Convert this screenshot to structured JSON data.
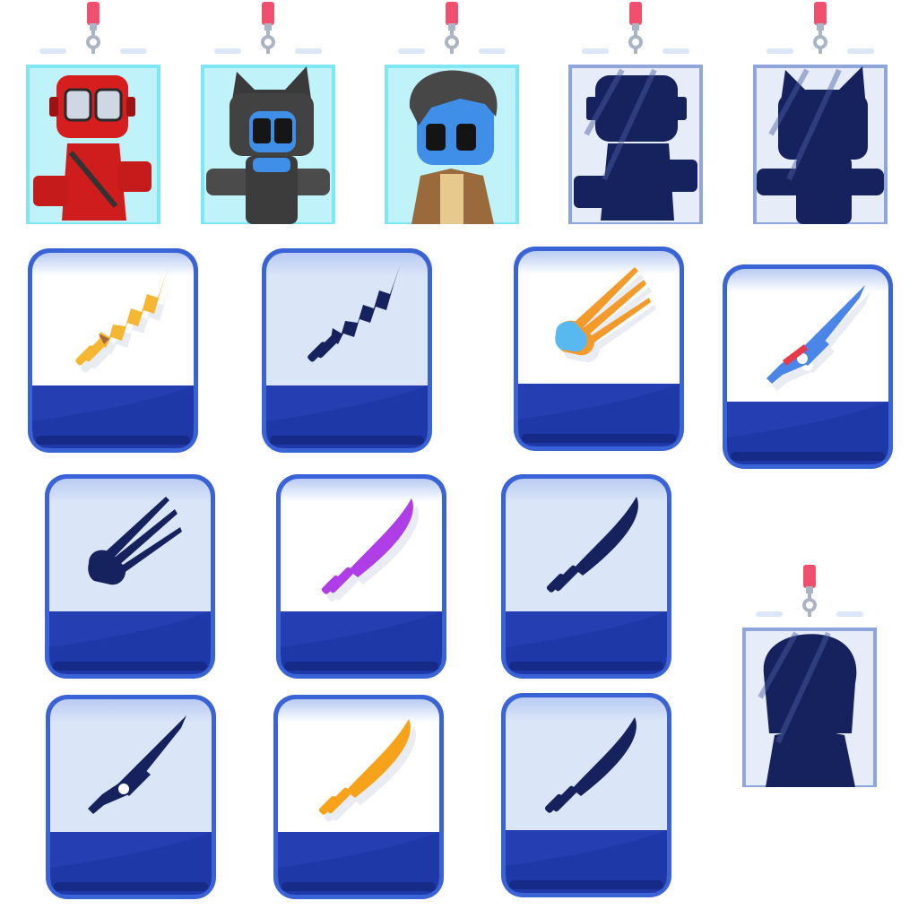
{
  "screen": {
    "title": "",
    "sections": [
      "character-badges",
      "weapon-cards"
    ]
  },
  "colors": {
    "lanyard_red": "#f0506e",
    "clip_grey": "#aab4c4",
    "unlocked_frame": "#7fe6f3",
    "unlocked_bg": "#bff3f9",
    "locked_frame": "#8ea6dc",
    "locked_bg": "#e6ecf8",
    "silhouette": "#16225e",
    "card_border": "#3b63d8",
    "card_top": "#dbe5f8",
    "card_bottom": "#1f38a8",
    "card_bottom_dark": "#162a88"
  },
  "characters": [
    {
      "id": "red-masked-robot",
      "state": "unlocked",
      "icon": "red-masked-robot-icon"
    },
    {
      "id": "cat-robot",
      "state": "unlocked",
      "icon": "cat-robot-icon"
    },
    {
      "id": "scout-soldier",
      "state": "unlocked",
      "icon": "scout-soldier-icon"
    },
    {
      "id": "masked-robot",
      "state": "locked",
      "icon": "masked-robot-silhouette-icon"
    },
    {
      "id": "cat-robot",
      "state": "locked",
      "icon": "cat-robot-silhouette-icon"
    },
    {
      "id": "scout-soldier",
      "state": "locked",
      "icon": "scout-soldier-silhouette-icon"
    }
  ],
  "weapons": [
    {
      "id": "lightning-sword",
      "state": "unlocked",
      "icon": "lightning-sword-icon",
      "color": "#f5b731"
    },
    {
      "id": "lightning-sword",
      "state": "locked",
      "icon": "lightning-sword-silhouette-icon"
    },
    {
      "id": "claw-blades",
      "state": "unlocked",
      "icon": "claw-blades-icon",
      "color": "#f39a2a"
    },
    {
      "id": "mech-blade",
      "state": "unlocked",
      "icon": "mech-blade-icon",
      "color": "#4a86e8"
    },
    {
      "id": "claw-blades",
      "state": "locked",
      "icon": "claw-blades-silhouette-icon"
    },
    {
      "id": "katana",
      "state": "unlocked",
      "icon": "purple-katana-icon",
      "color": "#b03ee8"
    },
    {
      "id": "katana",
      "state": "locked",
      "icon": "katana-silhouette-icon"
    },
    {
      "id": "mech-blade",
      "state": "locked",
      "icon": "mech-blade-silhouette-icon"
    },
    {
      "id": "katana",
      "state": "unlocked",
      "icon": "orange-katana-icon",
      "color": "#f7a21b"
    },
    {
      "id": "katana",
      "state": "locked",
      "icon": "katana-silhouette-icon"
    }
  ]
}
